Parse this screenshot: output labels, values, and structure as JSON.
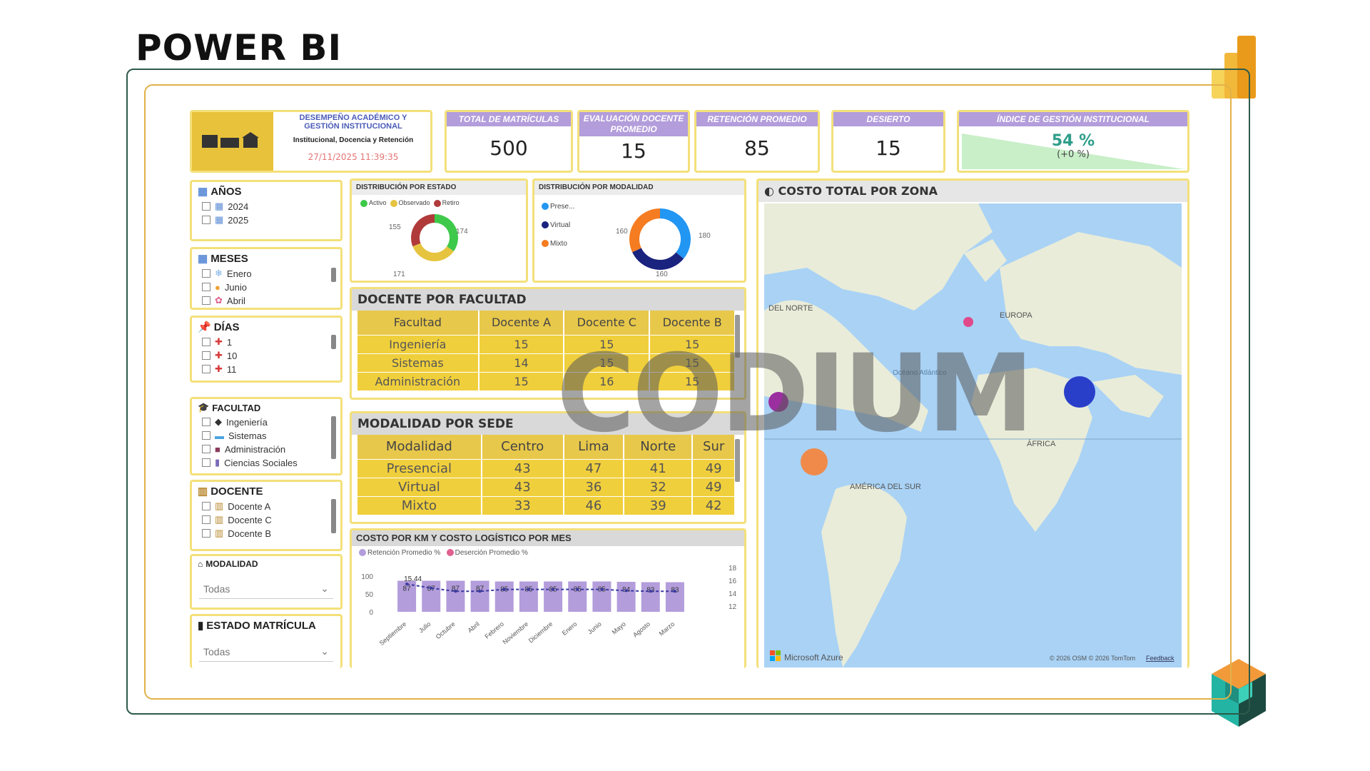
{
  "page_title": "POWER BI",
  "watermark": "CODIUM",
  "header": {
    "title_line1": "DESEMPEÑO ACADÉMICO Y",
    "title_line2": "GESTIÓN INSTITUCIONAL",
    "subtitle": "Institucional, Docencia y Retención",
    "timestamp": "27/11/2025  11:39:35"
  },
  "kpis": [
    {
      "label": "TOTAL DE MATRÍCULAS",
      "value": "500"
    },
    {
      "label": "EVALUACIÓN DOCENTE PROMEDIO",
      "value": "15"
    },
    {
      "label": "RETENCIÓN PROMEDIO",
      "value": "85"
    },
    {
      "label": "DESIERTO",
      "value": "15"
    }
  ],
  "index_kpi": {
    "label": "ÍNDICE DE GESTIÓN INSTITUCIONAL",
    "value": "54 %",
    "delta": "(+0 %)"
  },
  "slicers": {
    "anios": {
      "title": "AÑOS",
      "items": [
        "2024",
        "2025"
      ]
    },
    "meses": {
      "title": "MESES",
      "items": [
        "Enero",
        "Junio",
        "Abril"
      ]
    },
    "dias": {
      "title": "DÍAS",
      "items": [
        "1",
        "10",
        "11"
      ]
    },
    "facultad": {
      "title": "FACULTAD",
      "items": [
        "Ingeniería",
        "Sistemas",
        "Administración",
        "Ciencias Sociales"
      ]
    },
    "docente": {
      "title": "DOCENTE",
      "items": [
        "Docente A",
        "Docente C",
        "Docente B"
      ]
    },
    "modalidad": {
      "title": "MODALIDAD",
      "value": "Todas"
    },
    "estado": {
      "title": "ESTADO MATRÍCULA",
      "value": "Todas"
    }
  },
  "dist_estado": {
    "title": "DISTRIBUCIÓN POR ESTADO",
    "legend": [
      "Activo",
      "Observado",
      "Retiro"
    ],
    "colors": [
      "#3ec94a",
      "#e6c440",
      "#b03a3a"
    ],
    "values": [
      174,
      171,
      155
    ],
    "labels": [
      "155",
      "174",
      "171"
    ]
  },
  "dist_modalidad": {
    "title": "DISTRIBUCIÓN POR MODALIDAD",
    "legend": [
      "Prese...",
      "Virtual",
      "Mixto"
    ],
    "colors": [
      "#2196f3",
      "#1a237e",
      "#f57c20"
    ],
    "values": [
      180,
      160,
      160
    ],
    "labels": [
      "160",
      "180",
      "160"
    ]
  },
  "docente_facultad": {
    "title": "DOCENTE POR FACULTAD",
    "headers": [
      "Facultad",
      "Docente A",
      "Docente C",
      "Docente B"
    ],
    "rows": [
      [
        "Ingeniería",
        "15",
        "15",
        "15"
      ],
      [
        "Sistemas",
        "14",
        "15",
        "15"
      ],
      [
        "Administración",
        "15",
        "16",
        "15"
      ]
    ]
  },
  "modalidad_sede": {
    "title": "MODALIDAD POR SEDE",
    "headers": [
      "Modalidad",
      "Centro",
      "Lima",
      "Norte",
      "Sur"
    ],
    "rows": [
      [
        "Presencial",
        "43",
        "47",
        "41",
        "49"
      ],
      [
        "Virtual",
        "43",
        "36",
        "32",
        "49"
      ],
      [
        "Mixto",
        "33",
        "46",
        "39",
        "42"
      ]
    ]
  },
  "costo_chart": {
    "title": "COSTO POR KM Y COSTO LOGÍSTICO POR MES",
    "legend": [
      "Retención Promedio %",
      "Deserción Promedio %"
    ],
    "top_label": "15.44",
    "y_left": [
      "100",
      "50",
      "0"
    ],
    "y_right": [
      "18",
      "16",
      "14",
      "12"
    ]
  },
  "chart_data": {
    "type": "bar",
    "categories": [
      "Septiembre",
      "Julio",
      "Octubre",
      "Abril",
      "Febrero",
      "Noviembre",
      "Diciembre",
      "Enero",
      "Junio",
      "Mayo",
      "Agosto",
      "Marzo"
    ],
    "series": [
      {
        "name": "Retención Promedio %",
        "values": [
          87,
          87,
          87,
          87,
          85,
          85,
          85,
          85,
          85,
          84,
          83,
          83
        ]
      },
      {
        "name": "Deserción Promedio %",
        "values": [
          15.44,
          14.8,
          14.3,
          14.3,
          14.6,
          14.6,
          14.6,
          14.6,
          14.6,
          14.4,
          14.3,
          14.3
        ]
      }
    ],
    "ylim": [
      0,
      100
    ],
    "y2lim": [
      12,
      18
    ]
  },
  "map": {
    "title": "COSTO TOTAL POR ZONA",
    "labels": [
      "DEL NORTE",
      "EUROPA",
      "Océano Atlántico",
      "ÁFRICA",
      "AMÉRICA DEL SUR"
    ],
    "brand": "Microsoft Azure",
    "credits": "© 2026 OSM  © 2026 TomTom",
    "feedback": "Feedback"
  }
}
